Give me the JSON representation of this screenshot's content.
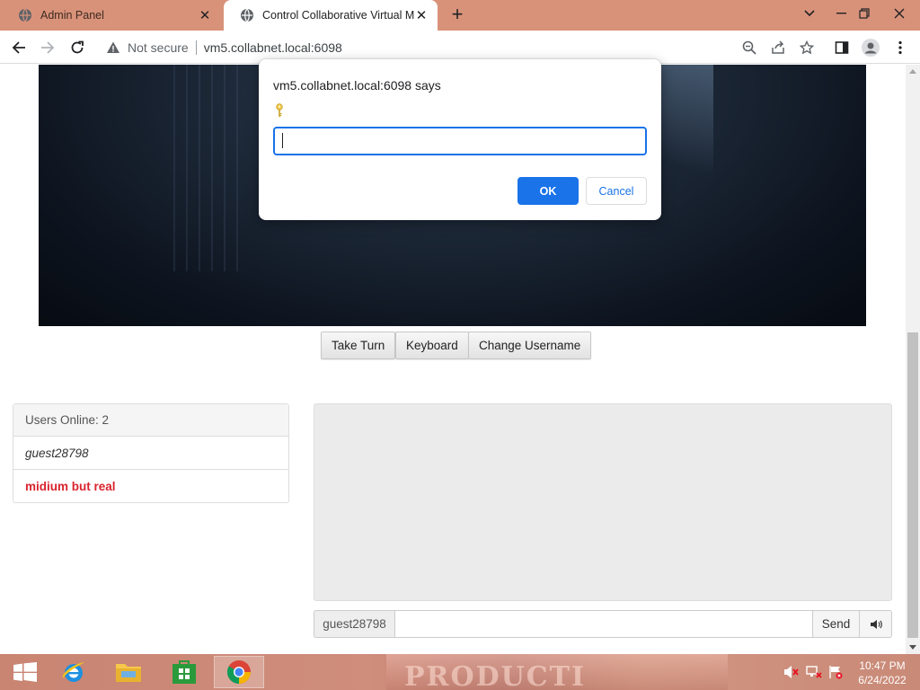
{
  "browser": {
    "tabs": [
      {
        "title": "Admin Panel",
        "active": false
      },
      {
        "title": "Control Collaborative Virtual Ma",
        "active": true
      }
    ],
    "omnibox": {
      "security_label": "Not secure",
      "url": "vm5.collabnet.local:6098"
    }
  },
  "vm_controls": {
    "take_turn": "Take Turn",
    "keyboard": "Keyboard",
    "change_username": "Change Username"
  },
  "users_panel": {
    "header": "Users Online: 2",
    "users": [
      {
        "name": "guest28798",
        "style": "guest"
      },
      {
        "name": "midium but real",
        "style": "owner",
        "color": "#d9232d"
      }
    ]
  },
  "chat": {
    "username": "guest28798",
    "input_value": "",
    "send_label": "Send"
  },
  "prompt_dialog": {
    "title": "vm5.collabnet.local:6098 says",
    "input_value": "",
    "ok_label": "OK",
    "cancel_label": "Cancel",
    "accent": "#1a73e8"
  },
  "taskbar": {
    "time": "10:47 PM",
    "date": "6/24/2022",
    "wallpaper_text": "PRODUCTI"
  }
}
